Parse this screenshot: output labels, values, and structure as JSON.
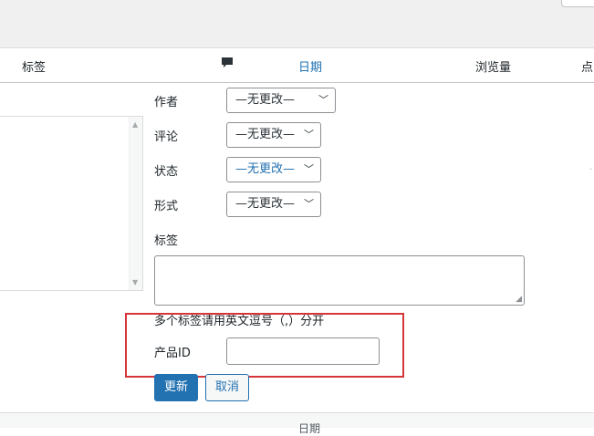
{
  "header": {
    "columns": {
      "tags": "标签",
      "date": "日期",
      "views": "浏览量",
      "more": "点"
    },
    "comment_icon": "speech-bubble-icon"
  },
  "bulk_edit": {
    "author": {
      "label": "作者",
      "value": "—无更改—"
    },
    "comment": {
      "label": "评论",
      "value": "—无更改—"
    },
    "status": {
      "label": "状态",
      "value": "—无更改—"
    },
    "format": {
      "label": "形式",
      "value": "—无更改—"
    },
    "tags": {
      "label": "标签",
      "value": ""
    },
    "tags_hint": "多个标签请用英文逗号（,）分开",
    "product_id": {
      "label": "产品ID",
      "value": ""
    }
  },
  "buttons": {
    "update": "更新",
    "cancel": "取消"
  },
  "bottom": {
    "cut_text": "日期"
  },
  "colors": {
    "accent": "#2271b1",
    "highlight": "#d63638"
  }
}
